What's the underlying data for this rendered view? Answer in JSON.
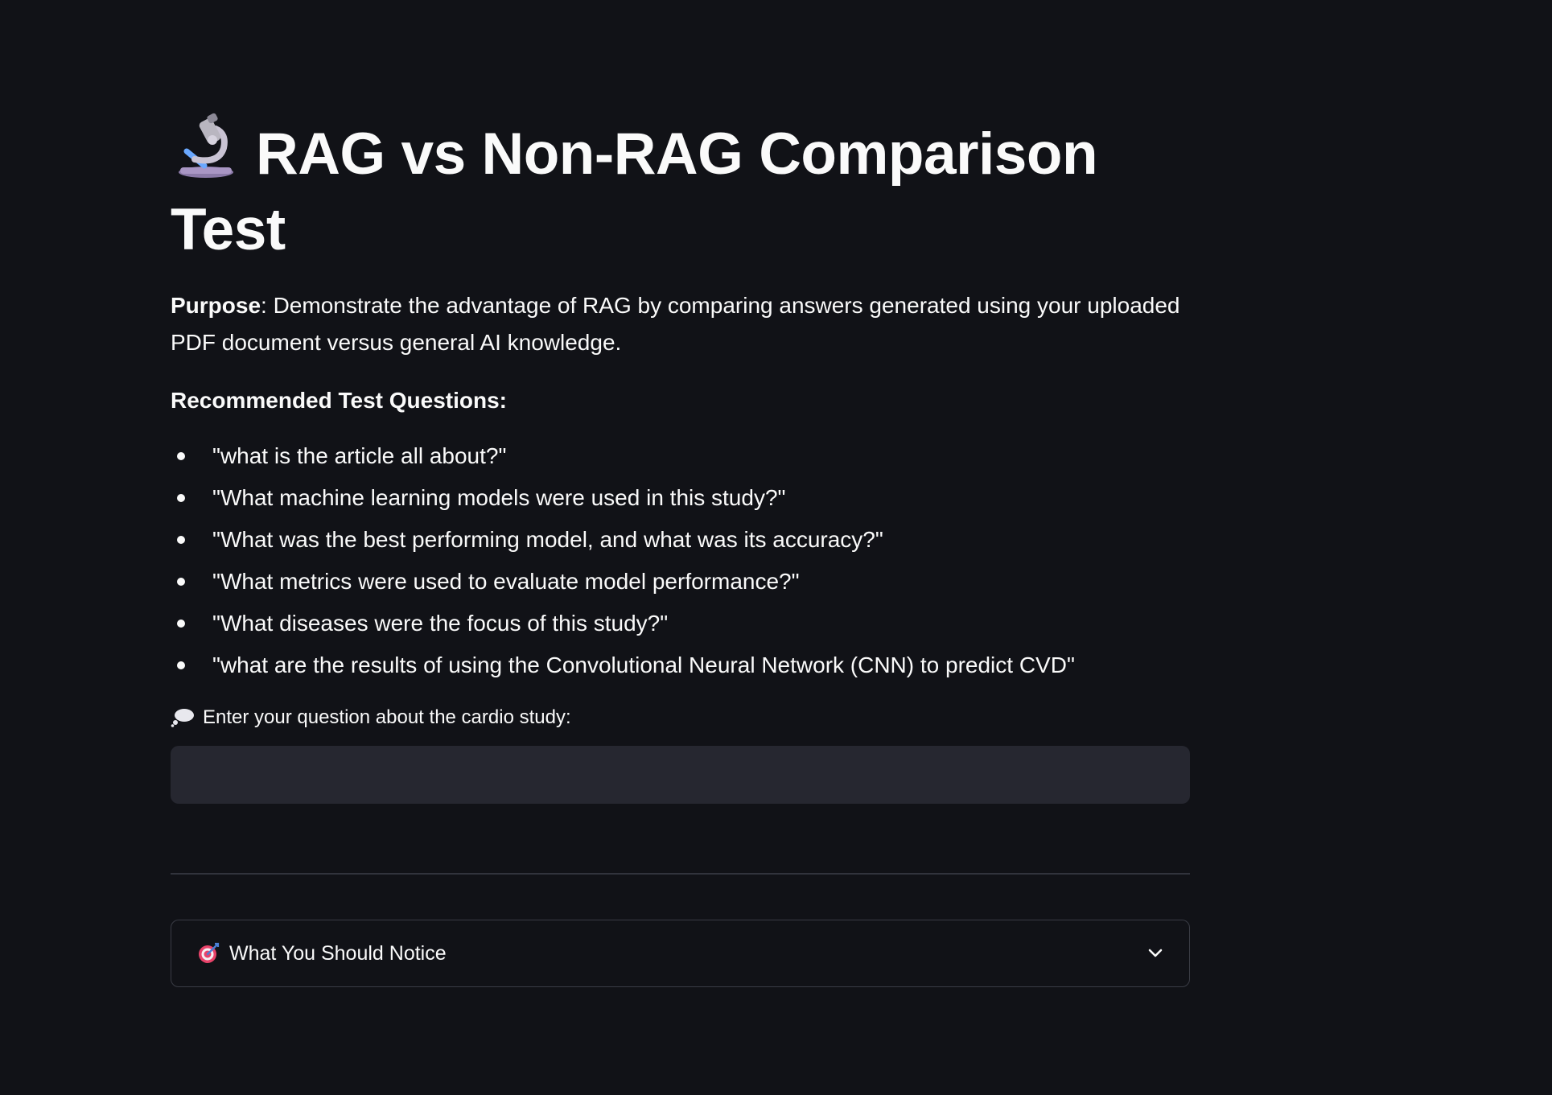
{
  "header": {
    "title": "RAG vs Non-RAG Comparison Test",
    "title_icon": "microscope-icon"
  },
  "purpose": {
    "label": "Purpose",
    "text": ": Demonstrate the advantage of RAG by comparing answers generated using your uploaded PDF document versus general AI knowledge."
  },
  "recommended": {
    "heading": "Recommended Test Questions:",
    "questions": [
      "\"what is the article all about?\"",
      "\"What machine learning models were used in this study?\"",
      "\"What was the best performing model, and what was its accuracy?\"",
      "\"What metrics were used to evaluate model performance?\"",
      "\"What diseases were the focus of this study?\"",
      "\"what are the results of using the Convolutional Neural Network (CNN) to predict CVD\""
    ]
  },
  "question_input": {
    "label": "Enter your question about the cardio study:",
    "label_icon": "thought-bubble-icon",
    "value": "",
    "placeholder": ""
  },
  "expander": {
    "label": "What You Should Notice",
    "icon": "target-icon",
    "chevron": "chevron-down-icon"
  },
  "colors": {
    "background": "#111217",
    "text": "#fafafa",
    "input_bg": "#262730",
    "border": "#3a3c45"
  }
}
